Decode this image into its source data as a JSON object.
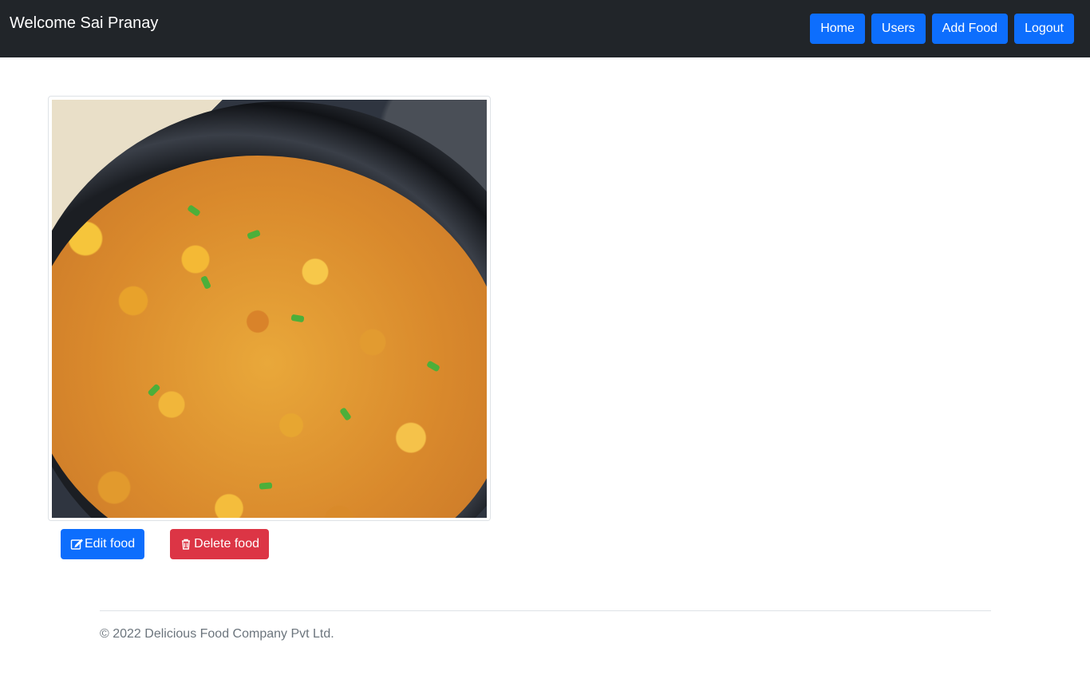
{
  "header": {
    "title": "Welcome Sai Pranay",
    "nav": [
      {
        "label": "Home",
        "icon": null
      },
      {
        "label": "Users",
        "icon": null
      },
      {
        "label": "Add Food",
        "icon": null
      },
      {
        "label": "Logout",
        "icon": null
      }
    ]
  },
  "food_card": {
    "image_subject": "masala sweet corn in a black plate"
  },
  "actions": {
    "edit_label": "Edit food",
    "edit_icon": "edit-icon",
    "delete_label": "Delete food",
    "delete_icon": "trash-icon"
  },
  "footer": {
    "text": "© 2022 Delicious Food Company Pvt Ltd."
  },
  "colors": {
    "navbar": "#212529",
    "primary": "#0d6efd",
    "danger": "#dc3545",
    "footer_text": "#6c757d"
  }
}
